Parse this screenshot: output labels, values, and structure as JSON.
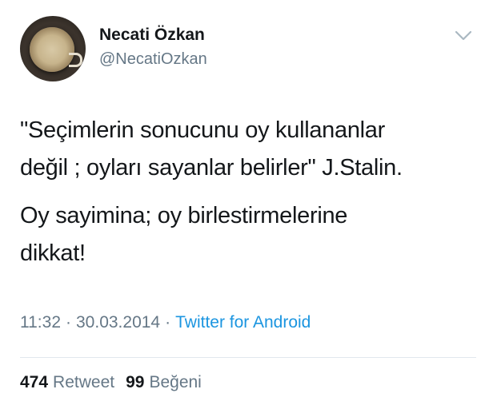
{
  "user": {
    "display_name": "Necati Özkan",
    "handle": "@NecatiOzkan",
    "avatar_icon": "avatar-image-coffee-cup"
  },
  "menu": {
    "icon": "chevron-down-icon",
    "color": "#aab8c2"
  },
  "tweet": {
    "paragraphs": [
      "\"Seçimlerin sonucunu oy kullananlar\ndeğil ; oyları sayanlar belirler\" J.Stalin.",
      "Oy sayimina; oy birlestirmelerine\ndikkat!"
    ]
  },
  "meta": {
    "time": "11:32",
    "separator": "·",
    "date": "30.03.2014",
    "source": "Twitter for Android",
    "link_color": "#1b95e0"
  },
  "stats": {
    "retweet_count": "474",
    "retweet_label": "Retweet",
    "like_count": "99",
    "like_label": "Beğeni"
  }
}
